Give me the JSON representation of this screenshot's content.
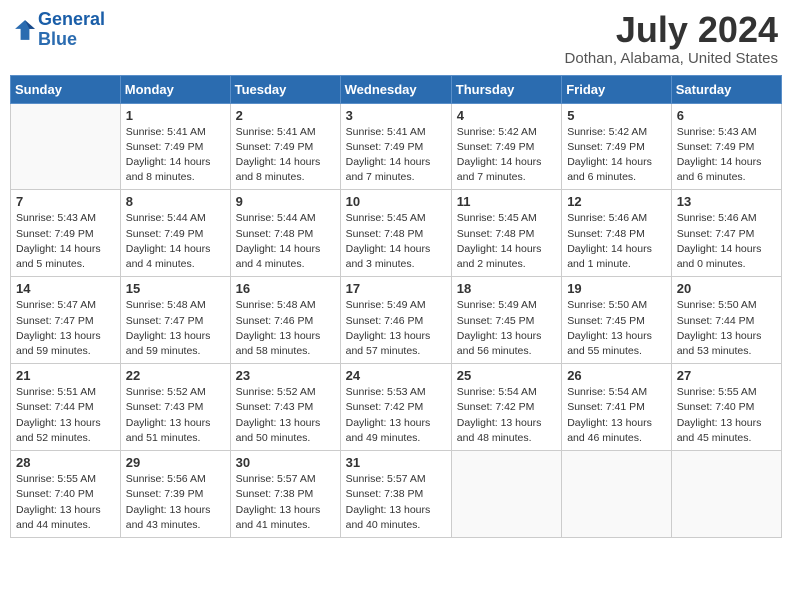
{
  "logo": {
    "text_general": "General",
    "text_blue": "Blue"
  },
  "title": "July 2024",
  "subtitle": "Dothan, Alabama, United States",
  "headers": [
    "Sunday",
    "Monday",
    "Tuesday",
    "Wednesday",
    "Thursday",
    "Friday",
    "Saturday"
  ],
  "weeks": [
    [
      {
        "day": "",
        "info": ""
      },
      {
        "day": "1",
        "info": "Sunrise: 5:41 AM\nSunset: 7:49 PM\nDaylight: 14 hours\nand 8 minutes."
      },
      {
        "day": "2",
        "info": "Sunrise: 5:41 AM\nSunset: 7:49 PM\nDaylight: 14 hours\nand 8 minutes."
      },
      {
        "day": "3",
        "info": "Sunrise: 5:41 AM\nSunset: 7:49 PM\nDaylight: 14 hours\nand 7 minutes."
      },
      {
        "day": "4",
        "info": "Sunrise: 5:42 AM\nSunset: 7:49 PM\nDaylight: 14 hours\nand 7 minutes."
      },
      {
        "day": "5",
        "info": "Sunrise: 5:42 AM\nSunset: 7:49 PM\nDaylight: 14 hours\nand 6 minutes."
      },
      {
        "day": "6",
        "info": "Sunrise: 5:43 AM\nSunset: 7:49 PM\nDaylight: 14 hours\nand 6 minutes."
      }
    ],
    [
      {
        "day": "7",
        "info": "Sunrise: 5:43 AM\nSunset: 7:49 PM\nDaylight: 14 hours\nand 5 minutes."
      },
      {
        "day": "8",
        "info": "Sunrise: 5:44 AM\nSunset: 7:49 PM\nDaylight: 14 hours\nand 4 minutes."
      },
      {
        "day": "9",
        "info": "Sunrise: 5:44 AM\nSunset: 7:48 PM\nDaylight: 14 hours\nand 4 minutes."
      },
      {
        "day": "10",
        "info": "Sunrise: 5:45 AM\nSunset: 7:48 PM\nDaylight: 14 hours\nand 3 minutes."
      },
      {
        "day": "11",
        "info": "Sunrise: 5:45 AM\nSunset: 7:48 PM\nDaylight: 14 hours\nand 2 minutes."
      },
      {
        "day": "12",
        "info": "Sunrise: 5:46 AM\nSunset: 7:48 PM\nDaylight: 14 hours\nand 1 minute."
      },
      {
        "day": "13",
        "info": "Sunrise: 5:46 AM\nSunset: 7:47 PM\nDaylight: 14 hours\nand 0 minutes."
      }
    ],
    [
      {
        "day": "14",
        "info": "Sunrise: 5:47 AM\nSunset: 7:47 PM\nDaylight: 13 hours\nand 59 minutes."
      },
      {
        "day": "15",
        "info": "Sunrise: 5:48 AM\nSunset: 7:47 PM\nDaylight: 13 hours\nand 59 minutes."
      },
      {
        "day": "16",
        "info": "Sunrise: 5:48 AM\nSunset: 7:46 PM\nDaylight: 13 hours\nand 58 minutes."
      },
      {
        "day": "17",
        "info": "Sunrise: 5:49 AM\nSunset: 7:46 PM\nDaylight: 13 hours\nand 57 minutes."
      },
      {
        "day": "18",
        "info": "Sunrise: 5:49 AM\nSunset: 7:45 PM\nDaylight: 13 hours\nand 56 minutes."
      },
      {
        "day": "19",
        "info": "Sunrise: 5:50 AM\nSunset: 7:45 PM\nDaylight: 13 hours\nand 55 minutes."
      },
      {
        "day": "20",
        "info": "Sunrise: 5:50 AM\nSunset: 7:44 PM\nDaylight: 13 hours\nand 53 minutes."
      }
    ],
    [
      {
        "day": "21",
        "info": "Sunrise: 5:51 AM\nSunset: 7:44 PM\nDaylight: 13 hours\nand 52 minutes."
      },
      {
        "day": "22",
        "info": "Sunrise: 5:52 AM\nSunset: 7:43 PM\nDaylight: 13 hours\nand 51 minutes."
      },
      {
        "day": "23",
        "info": "Sunrise: 5:52 AM\nSunset: 7:43 PM\nDaylight: 13 hours\nand 50 minutes."
      },
      {
        "day": "24",
        "info": "Sunrise: 5:53 AM\nSunset: 7:42 PM\nDaylight: 13 hours\nand 49 minutes."
      },
      {
        "day": "25",
        "info": "Sunrise: 5:54 AM\nSunset: 7:42 PM\nDaylight: 13 hours\nand 48 minutes."
      },
      {
        "day": "26",
        "info": "Sunrise: 5:54 AM\nSunset: 7:41 PM\nDaylight: 13 hours\nand 46 minutes."
      },
      {
        "day": "27",
        "info": "Sunrise: 5:55 AM\nSunset: 7:40 PM\nDaylight: 13 hours\nand 45 minutes."
      }
    ],
    [
      {
        "day": "28",
        "info": "Sunrise: 5:55 AM\nSunset: 7:40 PM\nDaylight: 13 hours\nand 44 minutes."
      },
      {
        "day": "29",
        "info": "Sunrise: 5:56 AM\nSunset: 7:39 PM\nDaylight: 13 hours\nand 43 minutes."
      },
      {
        "day": "30",
        "info": "Sunrise: 5:57 AM\nSunset: 7:38 PM\nDaylight: 13 hours\nand 41 minutes."
      },
      {
        "day": "31",
        "info": "Sunrise: 5:57 AM\nSunset: 7:38 PM\nDaylight: 13 hours\nand 40 minutes."
      },
      {
        "day": "",
        "info": ""
      },
      {
        "day": "",
        "info": ""
      },
      {
        "day": "",
        "info": ""
      }
    ]
  ]
}
